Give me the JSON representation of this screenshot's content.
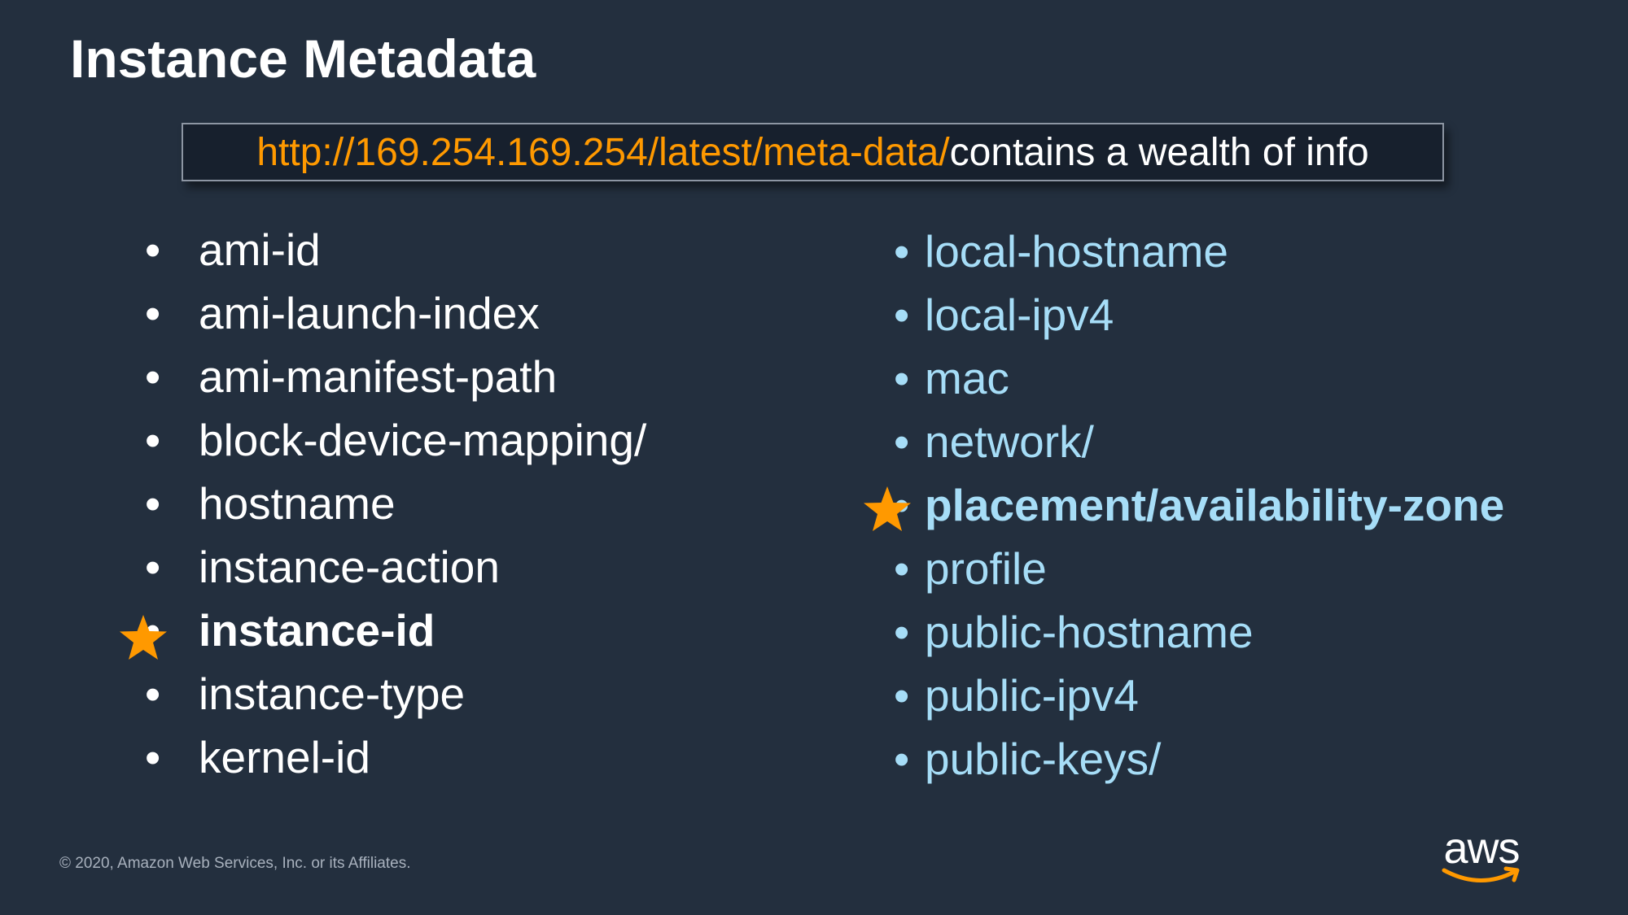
{
  "slide": {
    "title": "Instance Metadata"
  },
  "callout": {
    "url": "http://169.254.169.254/latest/meta-data/",
    "text": " contains a wealth of info"
  },
  "left_list": {
    "items": [
      {
        "label": "ami-id",
        "highlighted": false
      },
      {
        "label": "ami-launch-index",
        "highlighted": false
      },
      {
        "label": "ami-manifest-path",
        "highlighted": false
      },
      {
        "label": "block-device-mapping/",
        "highlighted": false
      },
      {
        "label": "hostname",
        "highlighted": false
      },
      {
        "label": "instance-action",
        "highlighted": false
      },
      {
        "label": "instance-id",
        "highlighted": true
      },
      {
        "label": "instance-type",
        "highlighted": false
      },
      {
        "label": "kernel-id",
        "highlighted": false
      }
    ]
  },
  "right_list": {
    "items": [
      {
        "label": "local-hostname",
        "highlighted": false
      },
      {
        "label": "local-ipv4",
        "highlighted": false
      },
      {
        "label": "mac",
        "highlighted": false
      },
      {
        "label": "network/",
        "highlighted": false
      },
      {
        "label": "placement/availability-zone",
        "highlighted": true
      },
      {
        "label": "profile",
        "highlighted": false
      },
      {
        "label": "public-hostname",
        "highlighted": false
      },
      {
        "label": "public-ipv4",
        "highlighted": false
      },
      {
        "label": "public-keys/",
        "highlighted": false
      }
    ]
  },
  "bullet_glyph": "•",
  "footer": {
    "copyright": "© 2020, Amazon Web Services, Inc. or its Affiliates."
  },
  "logo": {
    "text": "aws",
    "icon": "aws-logo-icon"
  },
  "colors": {
    "background": "#232f3e",
    "url_orange": "#ff9900",
    "right_list_blue": "#a6ddf7",
    "star": "#ff9900"
  }
}
